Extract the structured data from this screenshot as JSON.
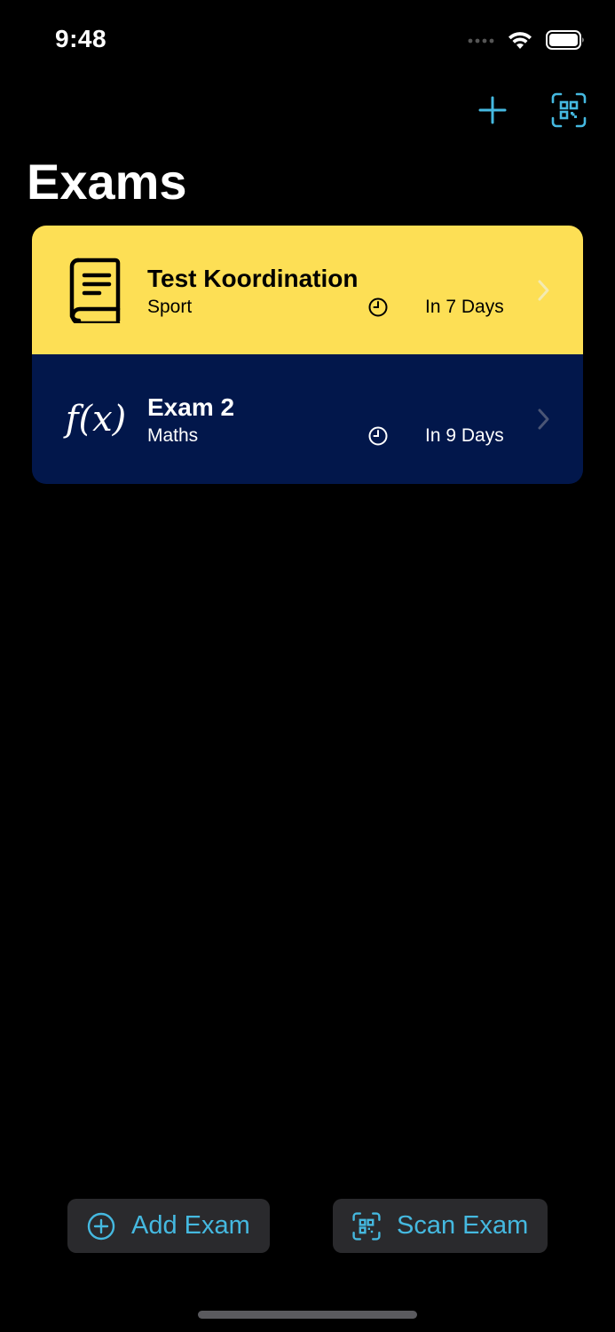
{
  "status_bar": {
    "time": "9:48"
  },
  "nav": {
    "add_icon": "plus-icon",
    "scan_icon": "qr-scan-icon"
  },
  "page": {
    "title": "Exams"
  },
  "exams": [
    {
      "title": "Test Koordination",
      "subject": "Sport",
      "due": "In 7 Days",
      "icon": "book-icon",
      "bg_color": "#fddf55",
      "text_color": "#000000"
    },
    {
      "title": "Exam 2",
      "subject": "Maths",
      "due": "In 9 Days",
      "icon": "function-icon",
      "icon_text": "f(x)",
      "bg_color": "#02174b",
      "text_color": "#ffffff"
    }
  ],
  "actions": {
    "add_label": "Add Exam",
    "scan_label": "Scan Exam"
  },
  "colors": {
    "accent": "#45b9e0",
    "background": "#000000",
    "button_bg": "#2a2a2d"
  }
}
